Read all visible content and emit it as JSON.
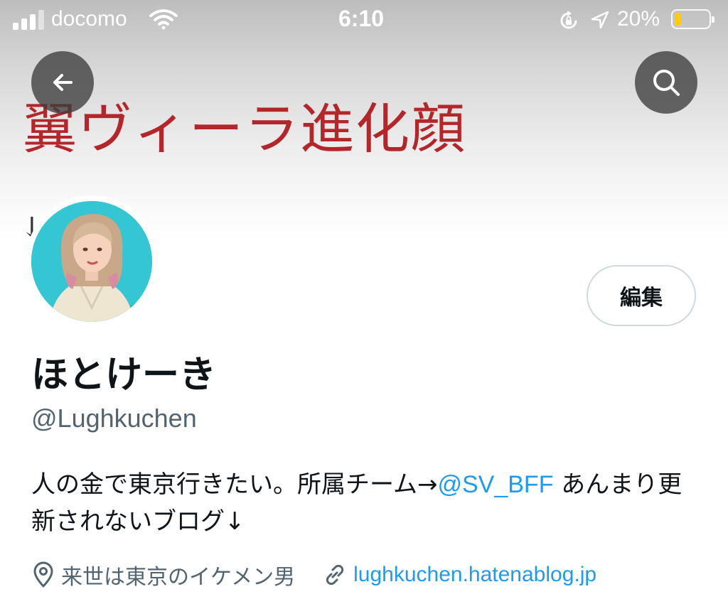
{
  "status_bar": {
    "carrier": "docomo",
    "time": "6:10",
    "battery_percent": "20%",
    "battery_level": 0.2
  },
  "header": {
    "banner_text": "翼ヴィーラ進化顔",
    "banner_fragment": "↓"
  },
  "profile": {
    "edit_label": "編集",
    "display_name": "ほとけーき",
    "handle": "@Lughkuchen",
    "bio_before": "人の金で東京行きたい。所属チーム→",
    "bio_mention": "@SV_BFF",
    "bio_after": " あんまり更新されないブログ↓",
    "location": "来世は東京のイケメン男",
    "website": "lughkuchen.hatenablog.jp"
  },
  "colors": {
    "link": "#1d9bf0",
    "banner_text": "#b3262a",
    "secondary_text": "#536471"
  },
  "icons": [
    "signal-icon",
    "wifi-icon",
    "rotation-lock-icon",
    "location-arrow-icon",
    "battery-icon",
    "back-arrow-icon",
    "search-icon",
    "location-pin-icon",
    "link-icon"
  ]
}
